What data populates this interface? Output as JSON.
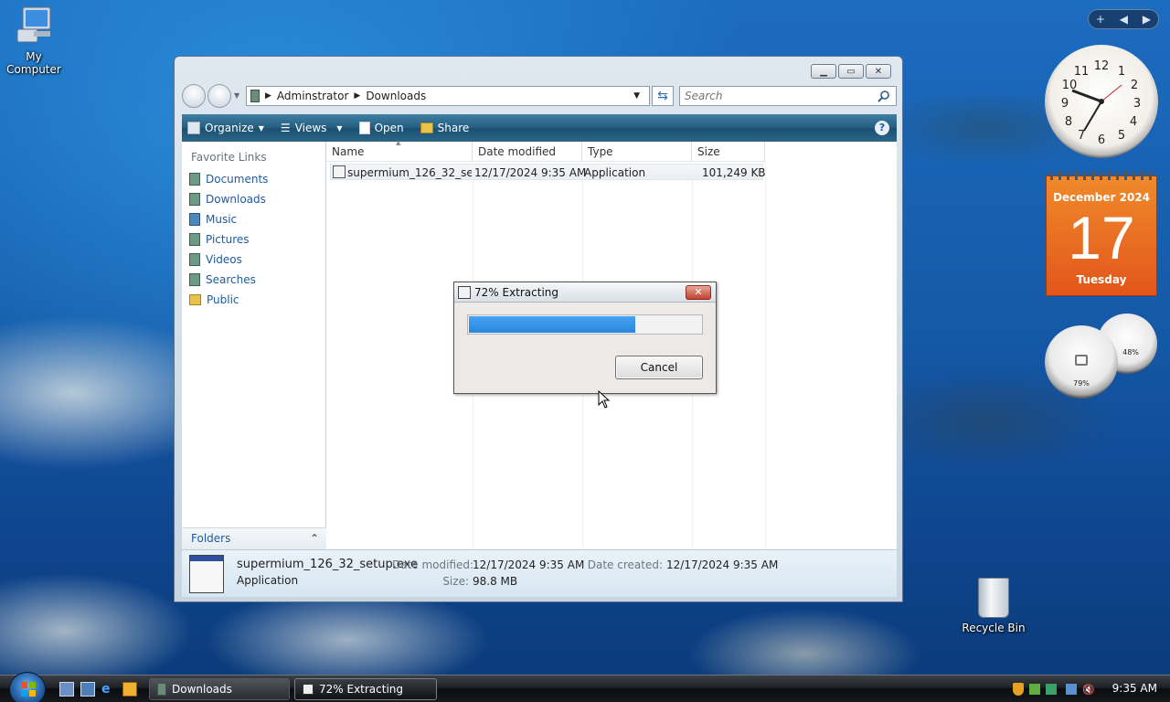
{
  "desktop": {
    "my_computer_label": "My\nComputer",
    "recycle_bin_label": "Recycle Bin"
  },
  "explorer": {
    "title": "Downloads",
    "breadcrumb": [
      "Adminstrator",
      "Downloads"
    ],
    "search_placeholder": "Search",
    "toolbar": {
      "organize": "Organize",
      "views": "Views",
      "open": "Open",
      "share": "Share"
    },
    "favorite_links_title": "Favorite Links",
    "favorite_links": [
      "Documents",
      "Downloads",
      "Music",
      "Pictures",
      "Videos",
      "Searches",
      "Public"
    ],
    "folders_label": "Folders",
    "columns": [
      "Name",
      "Date modified",
      "Type",
      "Size"
    ],
    "files": [
      {
        "name": "supermium_126_32_set...",
        "date": "12/17/2024 9:35 AM",
        "type": "Application",
        "size": "101,249 KB"
      }
    ],
    "details": {
      "filename": "supermium_126_32_setup.exe",
      "type": "Application",
      "date_modified_label": "Date modified:",
      "date_modified": "12/17/2024 9:35 AM",
      "size_label": "Size:",
      "size": "98.8 MB",
      "date_created_label": "Date created:",
      "date_created": "12/17/2024 9:35 AM"
    }
  },
  "dialog": {
    "title": "72% Extracting",
    "progress": 0.72,
    "cancel_label": "Cancel"
  },
  "gadgets": {
    "calendar": {
      "month": "December 2024",
      "day": "17",
      "weekday": "Tuesday"
    },
    "cpu_percent": "79%",
    "memory_percent": "48%"
  },
  "taskbar": {
    "items": [
      "Downloads",
      "72% Extracting"
    ],
    "time": "9:35 AM"
  }
}
